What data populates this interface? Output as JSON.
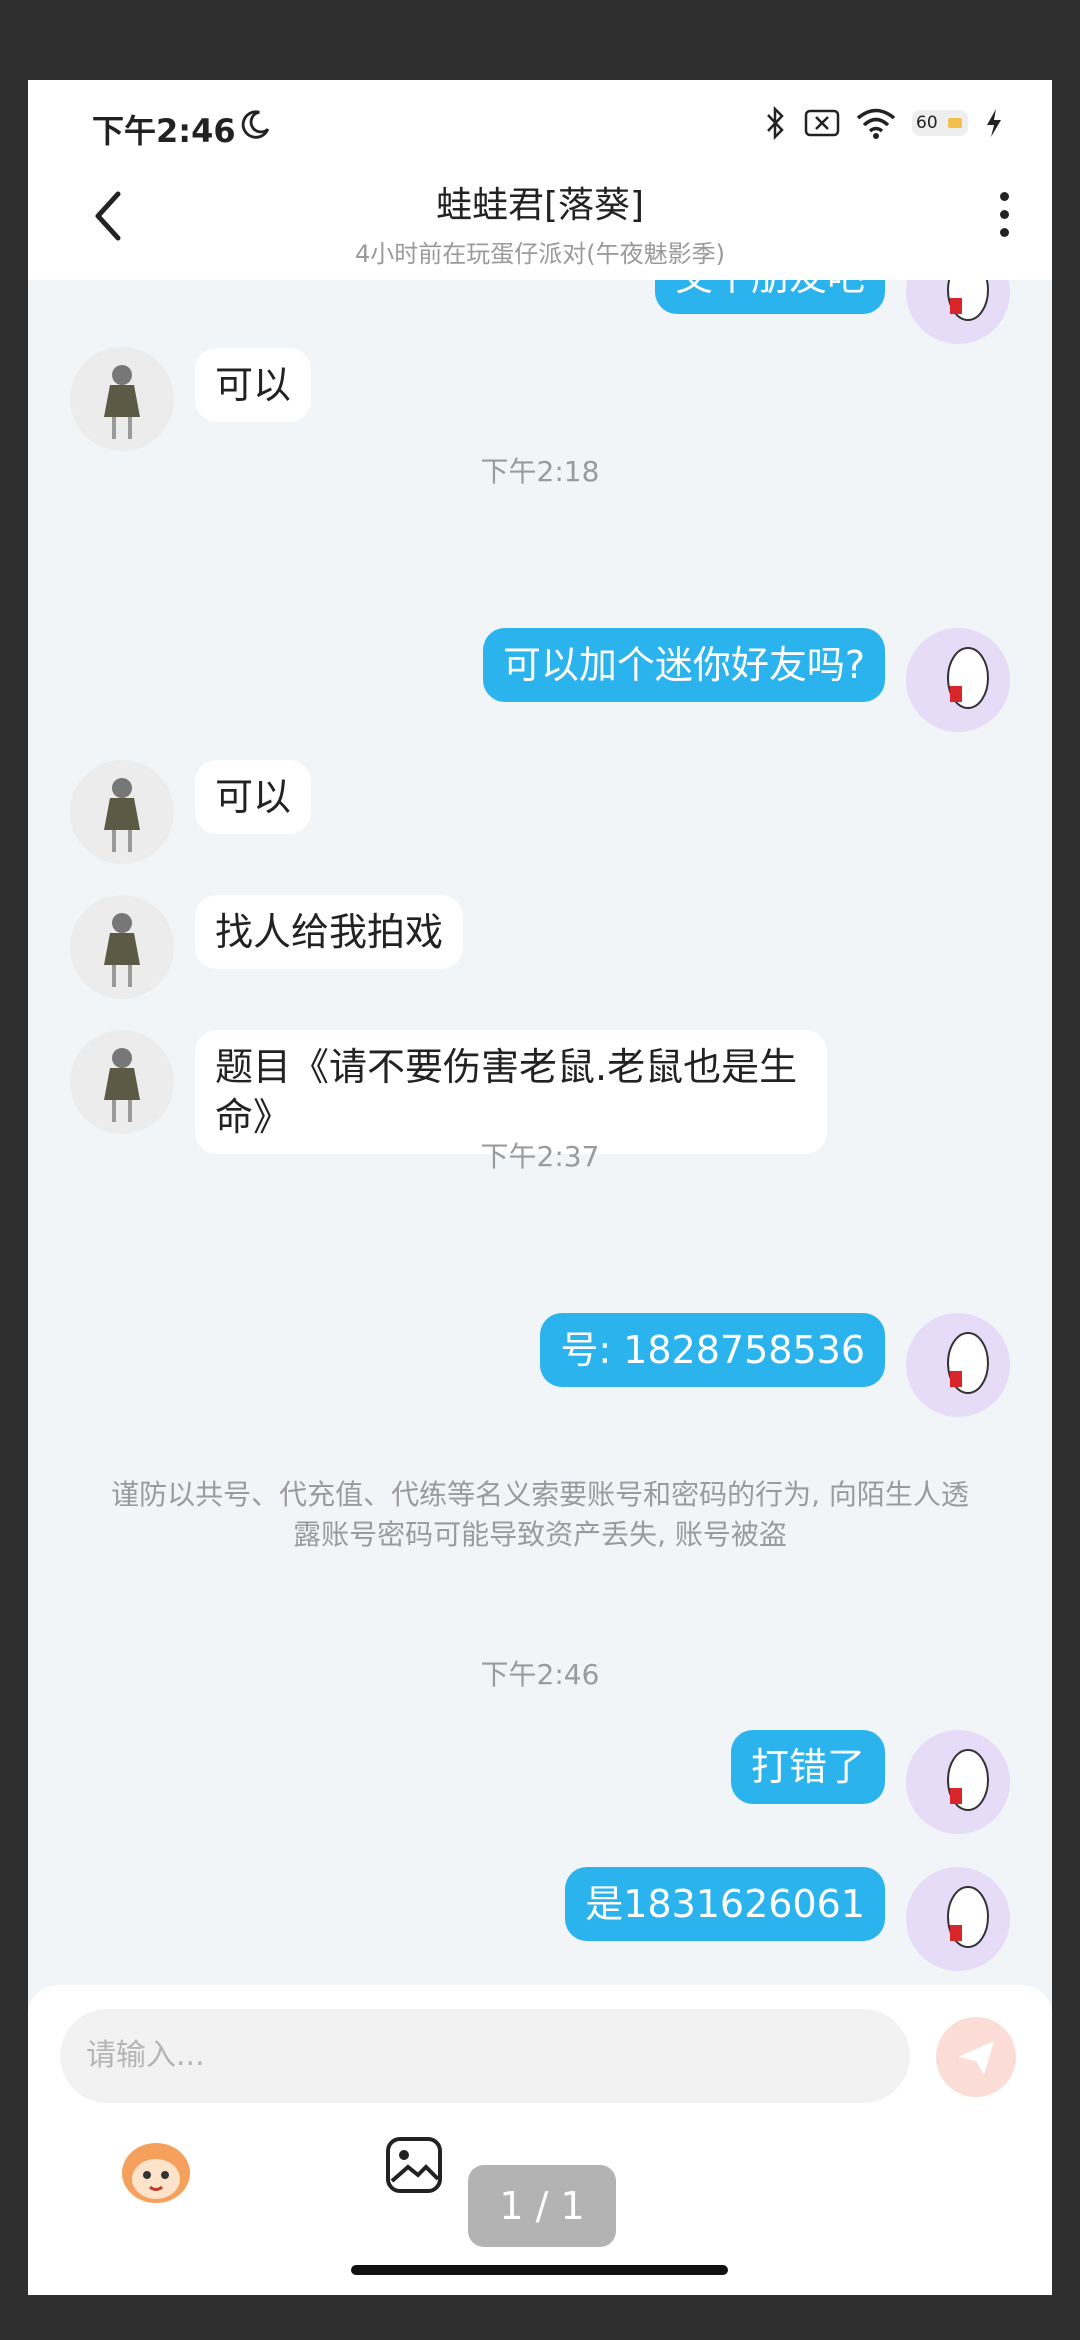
{
  "status": {
    "time": "下午2:46",
    "battery": "60"
  },
  "header": {
    "title": "蛙蛙君[落葵]",
    "subtitle": "4小时前在玩蛋仔派对(午夜魅影季)"
  },
  "messages": [
    {
      "side": "right",
      "text": "交个朋友吧"
    },
    {
      "side": "left",
      "text": "可以"
    },
    {
      "type": "time",
      "text": "下午2:18"
    },
    {
      "side": "right",
      "text": "可以加个迷你好友吗?"
    },
    {
      "side": "left",
      "text": "可以"
    },
    {
      "side": "left",
      "text": "找人给我拍戏"
    },
    {
      "side": "left",
      "text": "题目《请不要伤害老鼠.老鼠也是生命》"
    },
    {
      "type": "time",
      "text": "下午2:37"
    },
    {
      "side": "right",
      "text": "号: 1828758536"
    },
    {
      "type": "notice",
      "text": "谨防以共号、代充值、代练等名义索要账号和密码的行为, 向陌生人透露账号密码可能导致资产丢失, 账号被盗"
    },
    {
      "type": "time",
      "text": "下午2:46"
    },
    {
      "side": "right",
      "text": "打错了"
    },
    {
      "side": "right",
      "text": "是1831626061"
    }
  ],
  "input": {
    "placeholder": "请输入..."
  },
  "pager": "1 / 1",
  "colors": {
    "bubble_self": "#2bb3ee",
    "bubble_other": "#ffffff",
    "background": "#f2f5f8"
  }
}
